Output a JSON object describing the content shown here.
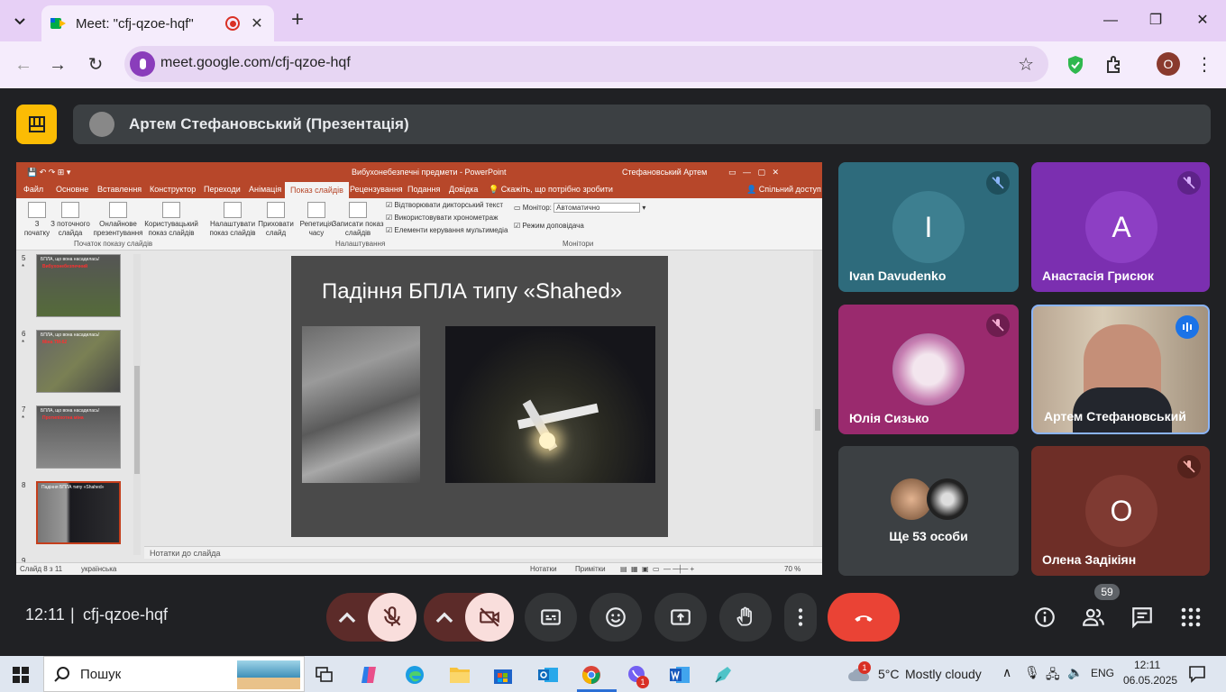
{
  "browser": {
    "tab_title": "Meet: \"cfj-qzoe-hqf\"",
    "url": "meet.google.com/cfj-qzoe-hqf",
    "profile_initial": "O"
  },
  "meet": {
    "presenter_label": "Артем Стефановський (Презентація)",
    "clock": "12:11",
    "separator": "|",
    "meeting_code": "cfj-qzoe-hqf",
    "participant_count": "59",
    "participants": [
      {
        "name": "Ivan Davudenko",
        "initial": "I",
        "muted": true
      },
      {
        "name": "Анастасія Грисюк",
        "initial": "A",
        "muted": true
      },
      {
        "name": "Юлія Сизько",
        "initial": "",
        "muted": true
      },
      {
        "name": "Артем Стефановський",
        "initial": "",
        "muted": false
      },
      {
        "name": "Ще 53 особи",
        "initial": "",
        "muted": false
      },
      {
        "name": "Олена Задікіян",
        "initial": "O",
        "muted": true
      }
    ]
  },
  "powerpoint": {
    "window_title": "Вибухонебезпечні предмети - PowerPoint",
    "user": "Стефановський Артем",
    "menu": [
      "Файл",
      "Основне",
      "Вставлення",
      "Конструктор",
      "Переходи",
      "Анімація",
      "Показ слайдів",
      "Рецензування",
      "Подання",
      "Довідка",
      "Скажіть, що потрібно зробити",
      "Спільний доступ"
    ],
    "ribbon": {
      "btn_from_start": "З початку",
      "btn_from_current": "З поточного слайда",
      "btn_online": "Онлайнове презентування",
      "btn_custom": "Користувацький показ слайдів",
      "btn_setup": "Налаштувати показ слайдів",
      "btn_hide": "Приховати слайд",
      "btn_rehearse": "Репетиція часу",
      "btn_record": "Записати показ слайдів",
      "check1": "Відтворювати дикторський текст",
      "check2": "Використовувати хронометраж",
      "check3": "Елементи керування мультимедіа",
      "monitor_label": "Монітор:",
      "monitor_value": "Автоматично",
      "presenter_view": "Режим доповідача",
      "group1": "Початок показу слайдів",
      "group2": "Налаштування",
      "group3": "Монітори"
    },
    "thumbs": [
      {
        "num": "5",
        "star": "*",
        "title": "БПЛА, що вона насадилась!",
        "red": "Вибухонебезпечний"
      },
      {
        "num": "6",
        "star": "*",
        "title": "БПЛА, що вона насадилась!",
        "red": "Міна ТМ-62"
      },
      {
        "num": "7",
        "star": "*",
        "title": "БПЛА, що вона насадилась!",
        "red": "Протипіхотна міна"
      },
      {
        "num": "8",
        "star": "",
        "title": "Падіння БПЛА типу «Shahed»",
        "red": ""
      },
      {
        "num": "9",
        "star": "",
        "title": "",
        "red": ""
      }
    ],
    "slide_title": "Падіння БПЛА типу «Shahed»",
    "notes_placeholder": "Нотатки до слайда",
    "status_slide": "Слайд 8 з 11",
    "status_lang": "українська",
    "status_notes": "Нотатки",
    "status_comments": "Примітки",
    "zoom": "70 %"
  },
  "taskbar": {
    "search_placeholder": "Пошук",
    "weather_temp": "5°C",
    "weather_desc": "Mostly cloudy",
    "lang": "ENG",
    "time": "12:11",
    "date": "06.05.2025",
    "viber_badge": "1",
    "weather_badge": "1"
  },
  "colors": {
    "meet_bg": "#202124",
    "end_call": "#ea4335",
    "mic_off": "#f9dedc",
    "pp_red": "#b7472a"
  }
}
